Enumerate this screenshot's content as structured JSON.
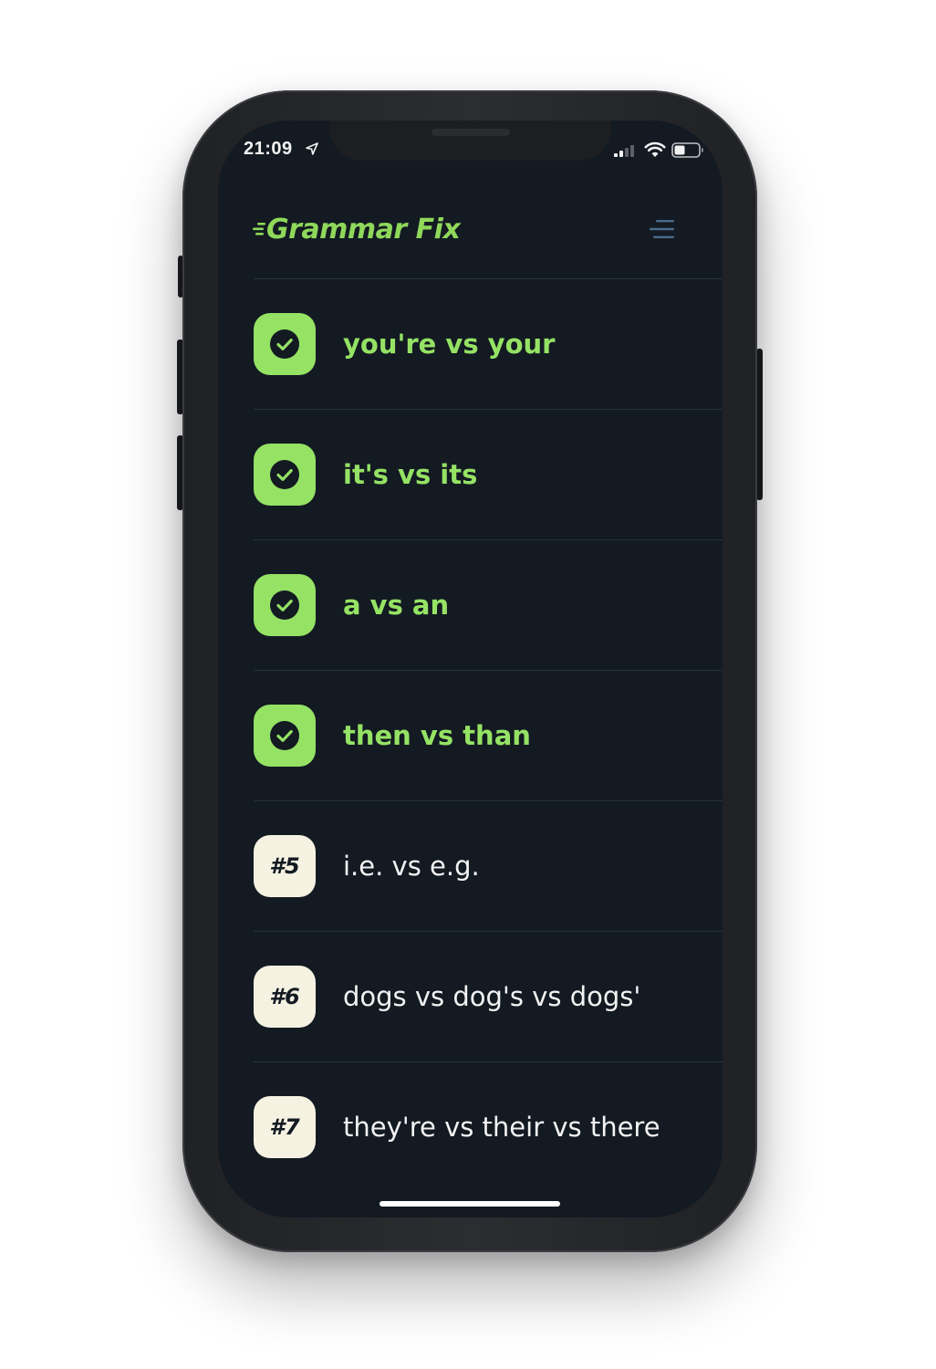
{
  "status_bar": {
    "time": "21:09",
    "location_icon": "location-arrow-icon",
    "signal_icon": "cellular-signal-icon",
    "wifi_icon": "wifi-icon",
    "battery_icon": "battery-icon"
  },
  "header": {
    "app_title": "Grammar Fix",
    "menu_icon": "hamburger-menu-icon"
  },
  "lessons": [
    {
      "label": "you're vs your",
      "status": "completed",
      "badge_icon": "check-circle-icon"
    },
    {
      "label": "it's vs its",
      "status": "completed",
      "badge_icon": "check-circle-icon"
    },
    {
      "label": "a vs an",
      "status": "completed",
      "badge_icon": "check-circle-icon"
    },
    {
      "label": "then vs than",
      "status": "completed",
      "badge_icon": "check-circle-icon"
    },
    {
      "label": "i.e. vs e.g.",
      "status": "pending",
      "badge": "#5"
    },
    {
      "label": "dogs vs dog's vs dogs'",
      "status": "pending",
      "badge": "#6"
    },
    {
      "label": "they're vs their vs there",
      "status": "pending",
      "badge": "#7"
    }
  ],
  "colors": {
    "background": "#131a22",
    "accent_green": "#95e264",
    "logo_green": "#8fd85a",
    "pending_badge": "#f6f2e2",
    "divider": "#26313e",
    "menu_icon": "#4a6c8c"
  }
}
